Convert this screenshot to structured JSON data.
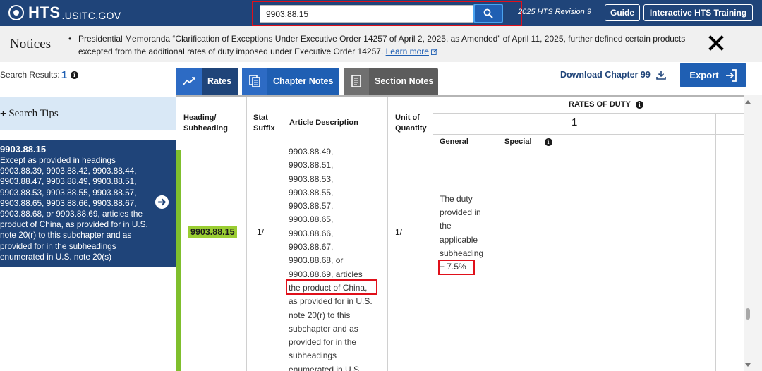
{
  "header": {
    "logo_main": "HTS",
    "logo_sub": ".USITC.GOV",
    "search_value": "9903.88.15",
    "revision": "2025 HTS Revision 9",
    "guide_label": "Guide",
    "training_label": "Interactive HTS Training"
  },
  "notices": {
    "title": "Notices",
    "text": "Presidential Memoranda “Clarification of Exceptions Under Executive Order 14257 of April 2, 2025, as Amended” of April 11, 2025, further defined certain products excepted from the additional rates of duty imposed under Executive Order 14257.",
    "learn_more": "Learn more"
  },
  "sidebar": {
    "results_label": "Search Results:",
    "results_count": "1",
    "search_tips": "Search Tips",
    "result": {
      "code": "9903.88.15",
      "description": "Except as provided in headings 9903.88.39, 9903.88.42, 9903.88.44, 9903.88.47, 9903.88.49, 9903.88.51, 9903.88.53, 9903.88.55, 9903.88.57, 9903.88.65, 9903.88.66, 9903.88.67, 9903.88.68, or 9903.88.69, articles the product of China, as provided for in U.S. note 20(r) to this subchapter and as provided for in the subheadings enumerated in U.S. note 20(s)"
    }
  },
  "tabs": {
    "rates": "Rates",
    "chapter_notes": "Chapter Notes",
    "section_notes": "Section Notes",
    "download": "Download Chapter 99",
    "export": "Export"
  },
  "table": {
    "headers": {
      "heading_line1": "Heading/",
      "heading_line2": "Subheading",
      "stat_line1": "Stat",
      "stat_line2": "Suffix",
      "article": "Article Description",
      "unit_line1": "Unit of",
      "unit_line2": "Quantity",
      "rates_of_duty": "RATES OF DUTY",
      "column_1": "1",
      "general": "General",
      "special": "Special"
    },
    "row": {
      "heading": "9903.88.15",
      "stat_suffix": "1/",
      "unit": "1/",
      "description_lines": [
        "9903.88.49,",
        "9903.88.51,",
        "9903.88.53,",
        "9903.88.55,",
        "9903.88.57,",
        "9903.88.65,",
        "9903.88.66,",
        "9903.88.67,",
        "9903.88.68, or",
        "9903.88.69, articles",
        "the product of China,",
        "as provided for in U.S.",
        "note 20(r) to this",
        "subchapter and as",
        "provided for in the",
        "subheadings",
        "enumerated in U.S."
      ],
      "general_lines": [
        "The duty",
        "provided in",
        "the",
        "applicable",
        "subheading",
        "+ 7.5%"
      ]
    }
  },
  "colors": {
    "navy": "#1f4479",
    "blue": "#1f5fb3",
    "highlight_green": "#9acd32",
    "annotation_red": "#e0101a"
  }
}
